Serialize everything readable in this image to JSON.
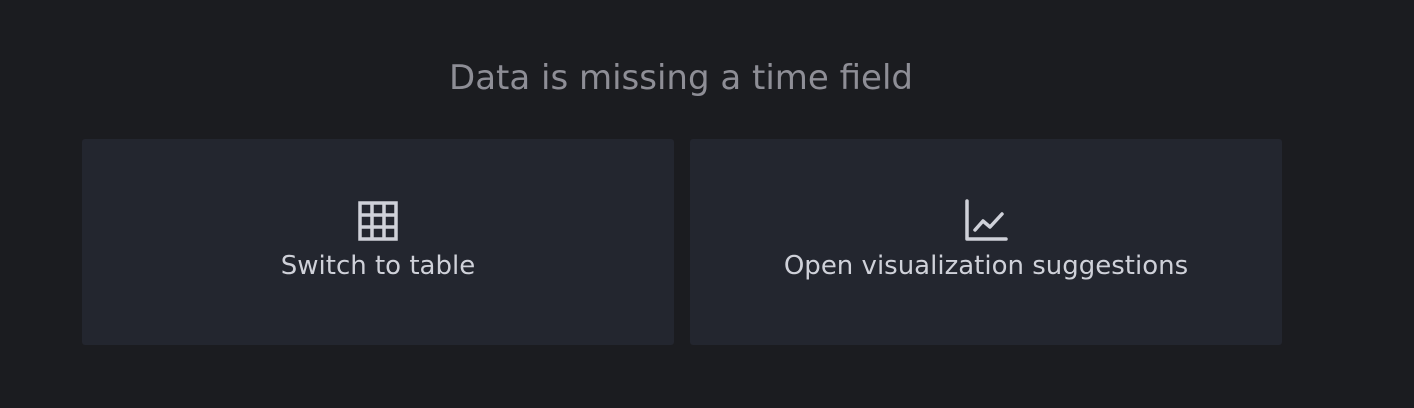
{
  "panel": {
    "message": "Data is missing a time field",
    "actions": [
      {
        "label": "Switch to table",
        "icon": "table-icon"
      },
      {
        "label": "Open visualization suggestions",
        "icon": "line-chart-icon"
      }
    ]
  },
  "colors": {
    "background": "#1b1c20",
    "card": "#23262f",
    "message_text": "#8e8e96",
    "card_text": "#cfd1d9"
  }
}
